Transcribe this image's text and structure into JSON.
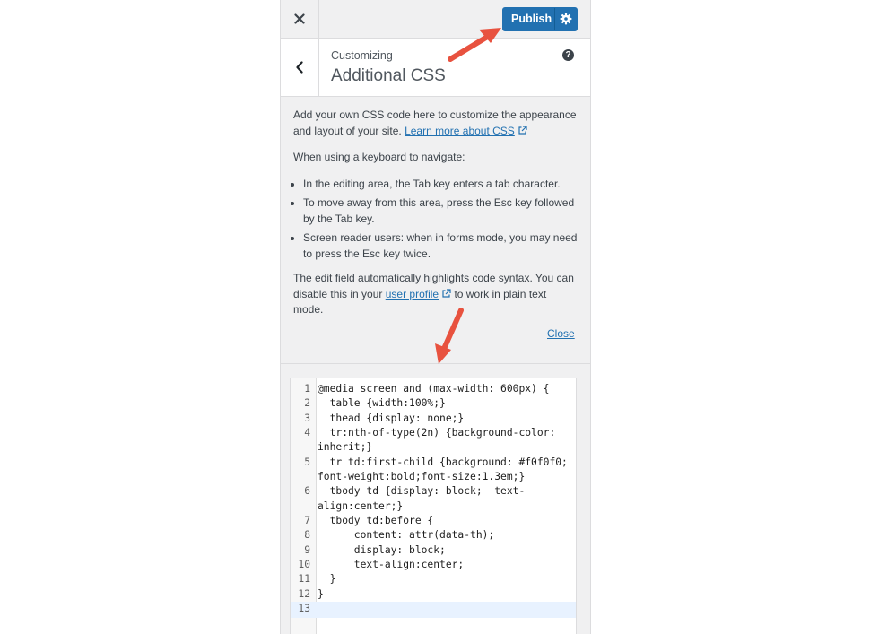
{
  "header": {
    "close_icon": "close-icon",
    "publish_label": "Publish",
    "settings_icon": "gear-icon"
  },
  "section": {
    "breadcrumb": "Customizing",
    "title": "Additional CSS",
    "help_symbol": "?"
  },
  "description": {
    "intro": "Add your own CSS code here to customize the appearance and layout of your site. ",
    "learn_more_link": "Learn more about CSS",
    "keyboard_heading": "When using a keyboard to navigate:",
    "bullets": [
      "In the editing area, the Tab key enters a tab character.",
      "To move away from this area, press the Esc key followed by the Tab key.",
      "Screen reader users: when in forms mode, you may need to press the Esc key twice."
    ],
    "syntax_pre": "The edit field automatically highlights code syntax. You can disable this in your ",
    "user_profile_link": "user profile",
    "syntax_post": " to work in plain text mode.",
    "close_link": "Close"
  },
  "editor": {
    "active_line": 13,
    "lines": [
      {
        "n": "1",
        "text": "@media screen and (max-width: 600px) {"
      },
      {
        "n": "2",
        "text": "  table {width:100%;}"
      },
      {
        "n": "3",
        "text": "  thead {display: none;}"
      },
      {
        "n": "4",
        "text": "  tr:nth-of-type(2n) {background-color:"
      },
      {
        "n": "",
        "text": "inherit;}"
      },
      {
        "n": "5",
        "text": "  tr td:first-child {background: #f0f0f0;"
      },
      {
        "n": "",
        "text": "font-weight:bold;font-size:1.3em;}"
      },
      {
        "n": "6",
        "text": "  tbody td {display: block;  text-"
      },
      {
        "n": "",
        "text": "align:center;}"
      },
      {
        "n": "7",
        "text": "  tbody td:before {"
      },
      {
        "n": "8",
        "text": "      content: attr(data-th);"
      },
      {
        "n": "9",
        "text": "      display: block;"
      },
      {
        "n": "10",
        "text": "      text-align:center;"
      },
      {
        "n": "11",
        "text": "  }"
      },
      {
        "n": "12",
        "text": "}"
      },
      {
        "n": "13",
        "text": ""
      }
    ]
  },
  "colors": {
    "accent": "#2271b1",
    "annotation_arrow": "#e8523f"
  }
}
